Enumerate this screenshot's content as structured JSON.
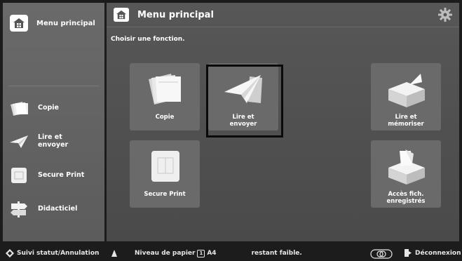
{
  "sidebar": {
    "home_label": "Menu principal",
    "items": [
      {
        "label": "Copie",
        "icon": "copy-icon"
      },
      {
        "label": "Lire et\nenvoyer",
        "icon": "scan-send-icon"
      },
      {
        "label": "Secure Print",
        "icon": "secure-print-icon"
      },
      {
        "label": "Didacticiel",
        "icon": "tutorial-signpost-icon"
      }
    ]
  },
  "main": {
    "title": "Menu principal",
    "subtitle": "Choisir une fonction.",
    "tiles": [
      {
        "label": "Copie",
        "icon": "copy-icon"
      },
      {
        "label": "Lire et\nenvoyer",
        "icon": "scan-send-icon",
        "selected": true
      },
      {
        "label": "Lire et\nmémoriser",
        "icon": "scan-store-icon"
      },
      {
        "label": "Secure Print",
        "icon": "secure-print-icon"
      },
      {
        "label": "Accès fich.\nenregistrés",
        "icon": "stored-files-icon"
      }
    ]
  },
  "statusbar": {
    "status_cancel": "Suivi statut/Annulation",
    "paper_level": "Niveau de papier",
    "paper_tray": "1",
    "paper_size": "A4",
    "paper_state": "restant faible.",
    "logout": "Déconnexion"
  }
}
